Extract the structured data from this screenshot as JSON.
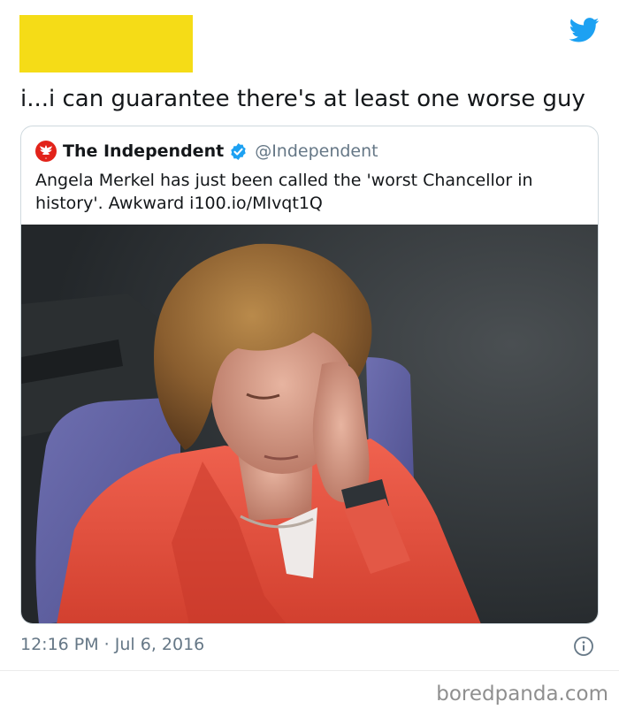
{
  "tweet": {
    "text": "i...i can guarantee there's at least one worse guy",
    "timestamp": "12:16 PM · Jul 6, 2016",
    "redaction_color": "#f5dc17"
  },
  "quoted_tweet": {
    "name": "The Independent",
    "handle": "@Independent",
    "verified": true,
    "text": "Angela Merkel has just been called the 'worst Chancellor in history'. Awkward i100.io/MIvqt1Q",
    "media": "photo"
  },
  "icons": {
    "platform": "twitter-bird-icon",
    "brand": "independent-eagle-logo",
    "verified": "verified-badge-icon",
    "info": "info-icon"
  },
  "colors": {
    "twitter_blue": "#1da1f2",
    "text": "#14171a",
    "muted": "#657786",
    "border": "#cfd9de"
  },
  "watermark": {
    "text": "boredpanda.com"
  }
}
